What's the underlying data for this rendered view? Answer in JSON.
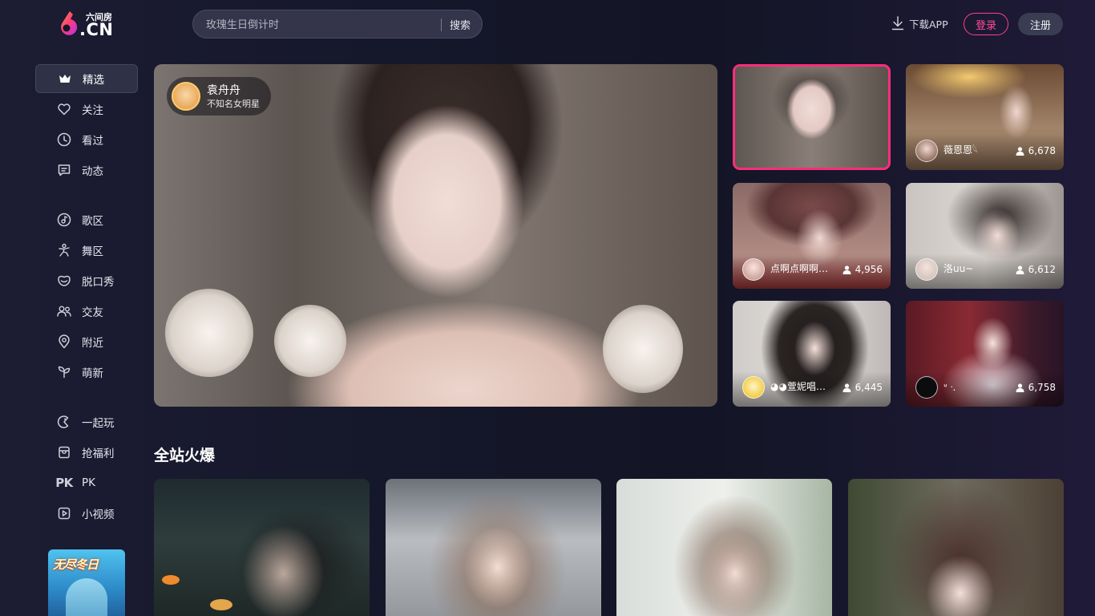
{
  "header": {
    "logo_sub": "六间房",
    "logo_main": ".CN",
    "search_placeholder": "玫瑰生日倒计时",
    "search_button": "搜索",
    "download_label": "下载APP",
    "login_label": "登录",
    "register_label": "注册"
  },
  "sidebar": {
    "items": [
      {
        "label": "精选",
        "icon": "crown-icon"
      },
      {
        "label": "关注",
        "icon": "heart-icon"
      },
      {
        "label": "看过",
        "icon": "clock-icon"
      },
      {
        "label": "动态",
        "icon": "message-icon"
      },
      {
        "label": "歌区",
        "icon": "music-icon"
      },
      {
        "label": "舞区",
        "icon": "dance-icon"
      },
      {
        "label": "脱口秀",
        "icon": "smile-icon"
      },
      {
        "label": "交友",
        "icon": "people-icon"
      },
      {
        "label": "附近",
        "icon": "location-icon"
      },
      {
        "label": "萌新",
        "icon": "sprout-icon"
      },
      {
        "label": "一起玩",
        "icon": "game-icon"
      },
      {
        "label": "抢福利",
        "icon": "gift-icon"
      },
      {
        "label": "PK",
        "icon": "pk-icon"
      },
      {
        "label": "小视频",
        "icon": "video-icon"
      }
    ],
    "banner_title": "无尽冬日"
  },
  "player": {
    "host_name": "袁舟舟",
    "host_desc": "不知名女明星"
  },
  "rooms": [
    {
      "name": "",
      "viewers": "",
      "selected": true
    },
    {
      "name": "薇恩恩𓆩",
      "viewers": "6,678"
    },
    {
      "name": "点啊点啊啊…",
      "viewers": "4,956"
    },
    {
      "name": "洛uu~",
      "viewers": "6,612"
    },
    {
      "name": "◕◕萱妮唱…",
      "viewers": "6,445"
    },
    {
      "name": "ᐡ ᐧ.",
      "viewers": "6,758"
    }
  ],
  "section": {
    "title": "全站火爆"
  },
  "colors": {
    "accent": "#ff2d7a",
    "background": "#15172a",
    "sidebar_active": "#2f3146"
  }
}
